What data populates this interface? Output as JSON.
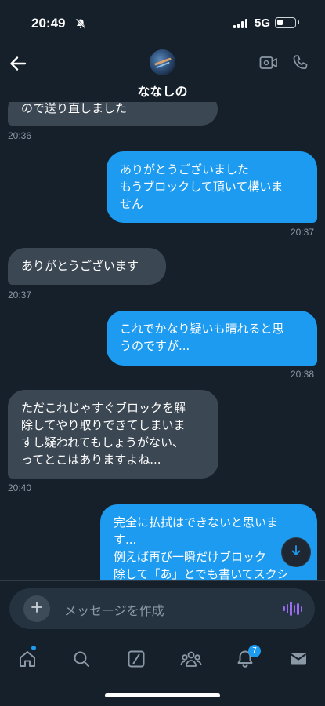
{
  "status_bar": {
    "time": "20:49",
    "network": "5G"
  },
  "header": {
    "contact_name": "ななしの"
  },
  "messages": [
    {
      "dir": "in",
      "text": "ので送り直しました",
      "time": "20:36"
    },
    {
      "dir": "out",
      "text": "ありがとうございました\nもうブロックして頂いて構いま\nせん",
      "time": "20:37"
    },
    {
      "dir": "in",
      "text": "ありがとうございます",
      "time": "20:37"
    },
    {
      "dir": "out",
      "text": "これでかなり疑いも晴れると思\nうのですが...",
      "time": "20:38"
    },
    {
      "dir": "in",
      "text": "ただこれじゃすぐブロックを解\n除してやり取りできてしまいま\nすし疑われてもしょうがない、\nってとこはありますよね...",
      "time": "20:40"
    },
    {
      "dir": "out",
      "text": "完全に払拭はできないと思いま\nす...\n例えば再び一瞬だけブロック\n除して「あ」とでも書いてスクシ",
      "time": ""
    }
  ],
  "composer": {
    "placeholder": "メッセージを作成"
  },
  "tabbar": {
    "notification_count": "7"
  },
  "colors": {
    "accent": "#1d9bf0",
    "background": "#15202b",
    "incoming_bubble": "#3b4753",
    "mic": "#9b6cf2"
  },
  "icons": [
    "back-arrow-icon",
    "video-call-icon",
    "phone-icon",
    "plus-icon",
    "voice-icon",
    "home-icon",
    "search-icon",
    "grok-icon",
    "communities-icon",
    "notifications-icon",
    "messages-icon",
    "chevron-down-icon"
  ]
}
